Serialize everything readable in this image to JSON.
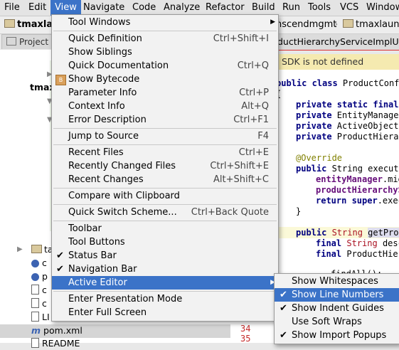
{
  "menubar": {
    "items": [
      "File",
      "Edit",
      "View",
      "Navigate",
      "Code",
      "Analyze",
      "Refactor",
      "Build",
      "Run",
      "Tools",
      "VCS",
      "Window"
    ]
  },
  "navbar": {
    "left_crumb": "tmaxla",
    "middle_crumb": "nscendmgmt",
    "right_crumb": "tmaxlaun"
  },
  "tool_window": {
    "tab_label": "Project"
  },
  "project_tree": {
    "row_tmaxla": "tmaxla",
    "row_ta": "ta",
    "row_c1": "c",
    "row_p": "p",
    "row_c2": "c",
    "row_c3": "c",
    "row_li": "LI",
    "row_pom": "pom.xml",
    "row_readme": "README"
  },
  "editor": {
    "tab_label": "ductHierarchyServiceImplUn",
    "warning": "SDK is not defined",
    "lines": {
      "l1": [
        "public class ",
        "ProductConfi"
      ],
      "l2": "{",
      "l3": [
        "private static final",
        ""
      ],
      "l4": [
        "private ",
        "EntityManager"
      ],
      "l5": [
        "private ",
        "ActiveObjects"
      ],
      "l6": [
        "private ",
        "ProductHierar"
      ],
      "l7": "@Override",
      "l8": [
        "public ",
        "String ",
        "execute"
      ],
      "l9": [
        "entityManager",
        ".mig"
      ],
      "l10": [
        "productHierarchyS"
      ],
      "l11": [
        "return super",
        ".exec"
      ],
      "l12": "}",
      "l13": [
        "public ",
        "String ",
        "getProd"
      ],
      "l14": [
        "final ",
        "String ",
        "desc"
      ],
      "l15": [
        "final ",
        "ProductHier"
      ],
      "l16": "findAll();"
    },
    "line_numbers": [
      "34",
      "35"
    ]
  },
  "view_menu": {
    "items": [
      {
        "label": "Tool Windows",
        "shortcut": "",
        "submenu": true
      },
      {
        "label": "Quick Definition",
        "shortcut": "Ctrl+Shift+I"
      },
      {
        "label": "Show Siblings",
        "shortcut": ""
      },
      {
        "label": "Quick Documentation",
        "shortcut": "Ctrl+Q"
      },
      {
        "label": "Show Bytecode",
        "shortcut": ""
      },
      {
        "label": "Parameter Info",
        "shortcut": "Ctrl+P"
      },
      {
        "label": "Context Info",
        "shortcut": "Alt+Q"
      },
      {
        "label": "Error Description",
        "shortcut": "Ctrl+F1"
      },
      {
        "label": "Jump to Source",
        "shortcut": "F4"
      },
      {
        "label": "Recent Files",
        "shortcut": "Ctrl+E"
      },
      {
        "label": "Recently Changed Files",
        "shortcut": "Ctrl+Shift+E"
      },
      {
        "label": "Recent Changes",
        "shortcut": "Alt+Shift+C"
      },
      {
        "label": "Compare with Clipboard",
        "shortcut": ""
      },
      {
        "label": "Quick Switch Scheme...",
        "shortcut": "Ctrl+Back Quote"
      },
      {
        "label": "Toolbar",
        "shortcut": ""
      },
      {
        "label": "Tool Buttons",
        "shortcut": ""
      },
      {
        "label": "Status Bar",
        "shortcut": "",
        "checked": true
      },
      {
        "label": "Navigation Bar",
        "shortcut": "",
        "checked": true
      },
      {
        "label": "Active Editor",
        "shortcut": "",
        "submenu": true,
        "selected": true
      },
      {
        "label": "Enter Presentation Mode",
        "shortcut": ""
      },
      {
        "label": "Enter Full Screen",
        "shortcut": ""
      }
    ]
  },
  "active_editor_submenu": {
    "items": [
      {
        "label": "Show Whitespaces",
        "checked": false
      },
      {
        "label": "Show Line Numbers",
        "checked": true,
        "selected": true
      },
      {
        "label": "Show Indent Guides",
        "checked": true
      },
      {
        "label": "Use Soft Wraps",
        "checked": false
      },
      {
        "label": "Show Import Popups",
        "checked": true
      }
    ]
  },
  "colors": {
    "selection": "#3b73c8",
    "menu_bg": "#f2f2f2",
    "keyword": "#000080",
    "annotation": "#808000",
    "warning_bg": "#f5eab0"
  }
}
